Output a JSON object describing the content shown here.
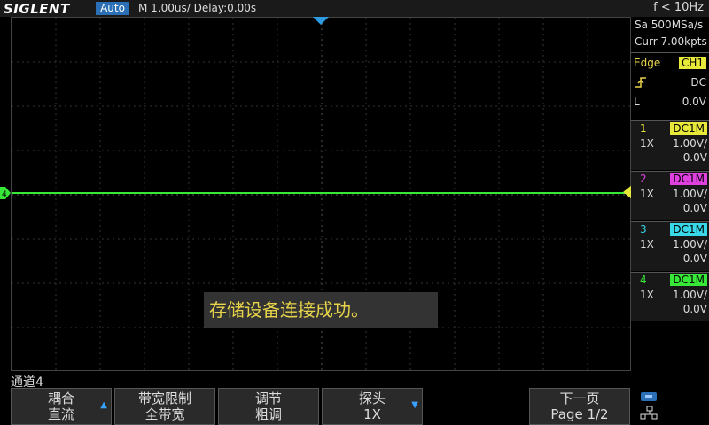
{
  "topbar": {
    "logo": "SIGLENT",
    "mode": "Auto",
    "timebase": "M 1.00us/  Delay:0.00s",
    "frequency": "f < 10Hz"
  },
  "acquisition": {
    "sample_rate": "Sa 500MSa/s",
    "memory_depth": "Curr 7.00kpts"
  },
  "trigger": {
    "type": "Edge",
    "source": "CH1",
    "coupling": "DC",
    "level_label": "L",
    "level": "0.0V",
    "slope_icon": "rising-edge-icon"
  },
  "channels": [
    {
      "num": "1",
      "coupling": "DC1M",
      "probe": "1X",
      "scale": "1.00V/",
      "offset": "0.0V",
      "color": "#e8e83a"
    },
    {
      "num": "2",
      "coupling": "DC1M",
      "probe": "1X",
      "scale": "1.00V/",
      "offset": "0.0V",
      "color": "#e040e0"
    },
    {
      "num": "3",
      "coupling": "DC1M",
      "probe": "1X",
      "scale": "1.00V/",
      "offset": "0.0V",
      "color": "#38d8e8"
    },
    {
      "num": "4",
      "coupling": "DC1M",
      "probe": "1X",
      "scale": "1.00V/",
      "offset": "0.0V",
      "color": "#38e838"
    }
  ],
  "trace": {
    "channel_marker": "4",
    "color": "#38e838"
  },
  "message": "存储设备连接成功。",
  "menu": {
    "title": "通道4",
    "items": [
      {
        "line1": "耦合",
        "line2": "直流",
        "arrow": "up"
      },
      {
        "line1": "带宽限制",
        "line2": "全带宽",
        "arrow": ""
      },
      {
        "line1": "调节",
        "line2": "粗调",
        "arrow": ""
      },
      {
        "line1": "探头",
        "line2": "1X",
        "arrow": "down"
      },
      {
        "line1": "下一页",
        "line2": "Page 1/2",
        "arrow": ""
      }
    ]
  },
  "colors": {
    "accent": "#2b6fb6",
    "trace": "#38e838",
    "message": "#e8d44a"
  }
}
